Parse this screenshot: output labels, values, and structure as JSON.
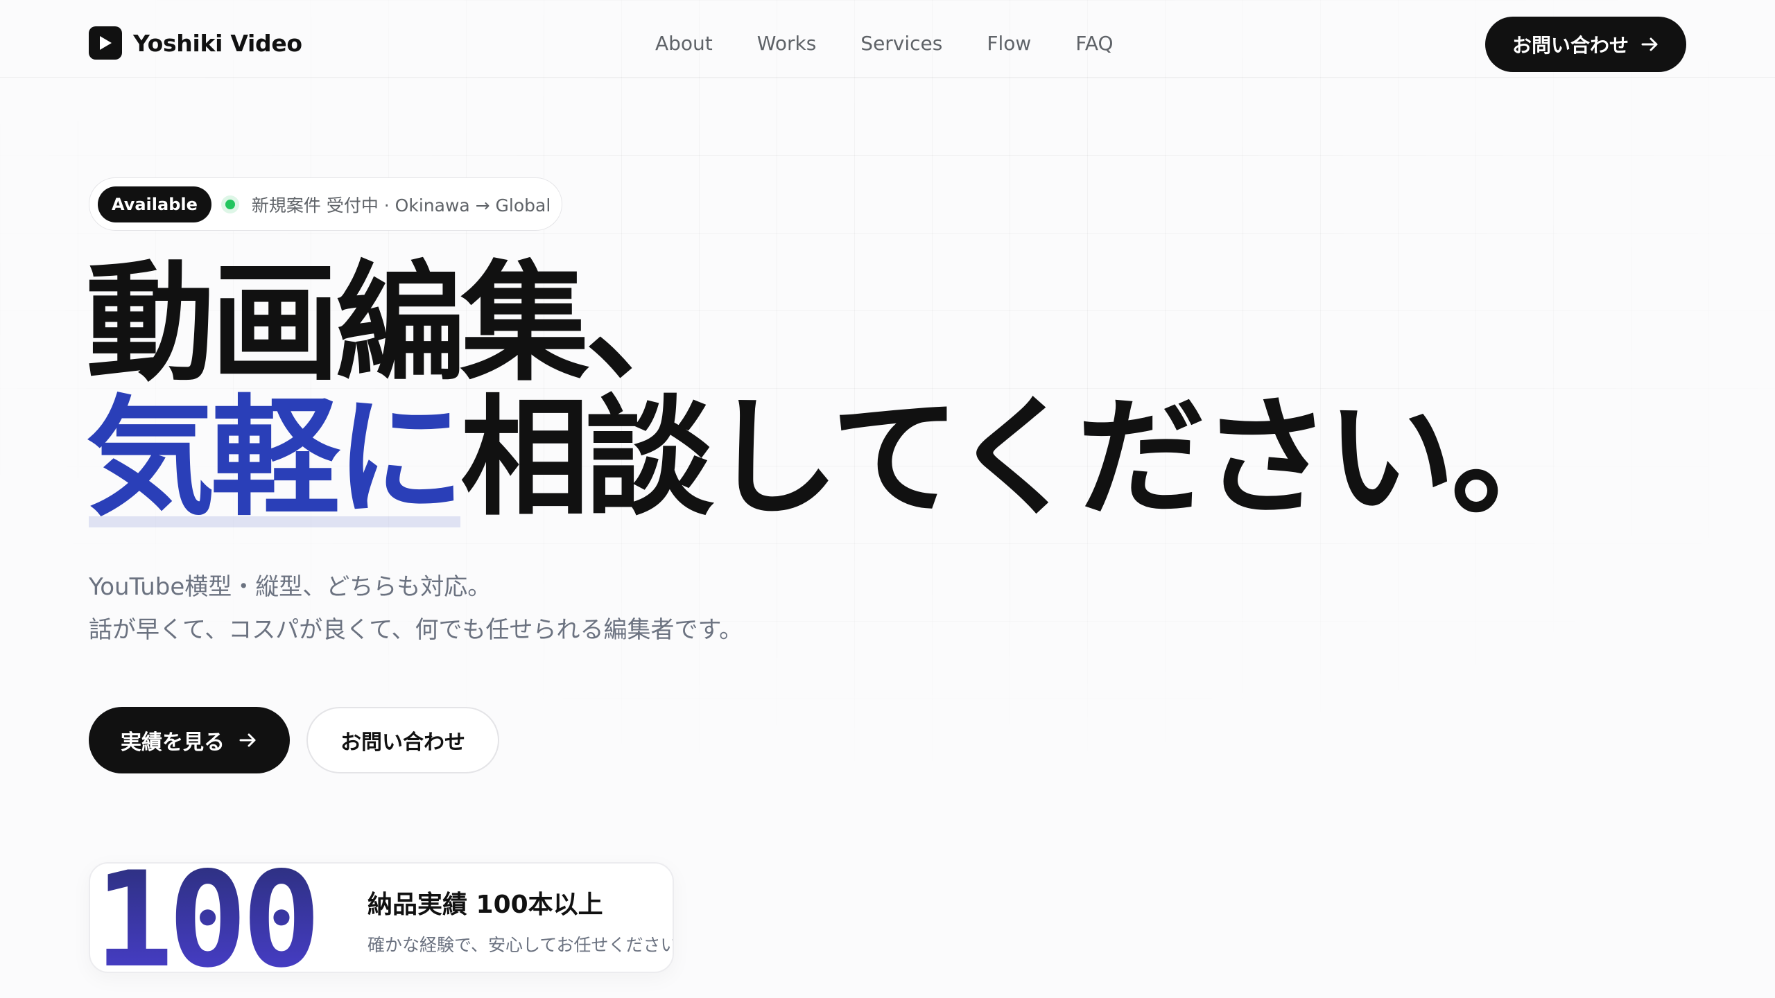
{
  "brand": {
    "name": "Yoshiki Video",
    "logo_icon": "play-icon"
  },
  "nav": {
    "items": [
      "About",
      "Works",
      "Services",
      "Flow",
      "FAQ"
    ]
  },
  "header": {
    "cta_label": "お問い合わせ",
    "cta_icon": "arrow-right-icon"
  },
  "badge": {
    "pill": "Available",
    "status_color": "#22c55e",
    "text": "新規案件 受付中 · Okinawa → Global"
  },
  "hero": {
    "line1": "動画編集、",
    "line2_accent": "気軽に",
    "line2_rest": "相談してください。",
    "sub1": "YouTube横型・縦型、どちらも対応。",
    "sub2": "話が早くて、コスパが良くて、何でも任せられる編集者です。",
    "primary_label": "実績を見る",
    "secondary_label": "お問い合わせ"
  },
  "stat": {
    "number": "100",
    "title": "納品実績 100本以上",
    "desc": "確かな経験で、安心してお任せください。"
  },
  "colors": {
    "accent": "#2a3fb8",
    "ink": "#111111",
    "muted": "#6b7280"
  }
}
